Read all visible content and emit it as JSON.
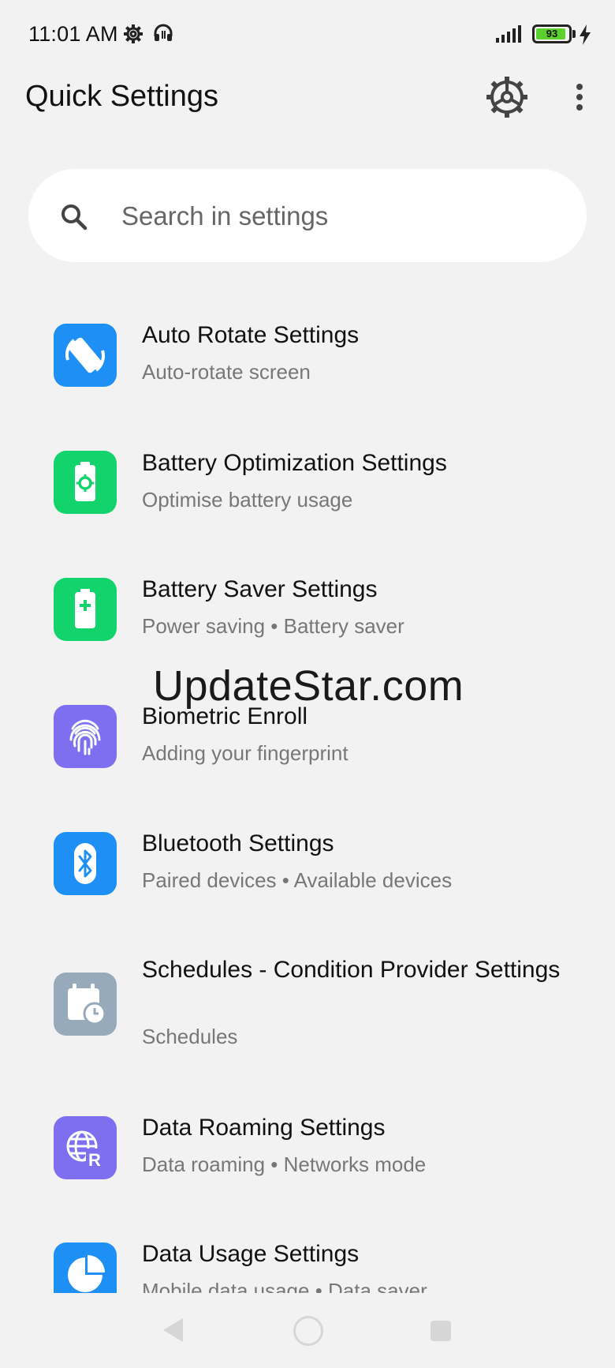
{
  "status_bar": {
    "time": "11:01 AM",
    "battery_level": "93",
    "battery_percent": 93,
    "icons": [
      "settings-gear-icon",
      "headset-icon",
      "signal-icon",
      "battery-icon",
      "charging-icon"
    ]
  },
  "header": {
    "title": "Quick Settings",
    "settings_icon": "gear-icon",
    "more_icon": "more-vert-icon"
  },
  "search": {
    "placeholder": "Search in settings",
    "icon": "search-icon"
  },
  "items": [
    {
      "title": "Auto Rotate Settings",
      "subtitle": "Auto-rotate screen",
      "icon": "rotate-icon",
      "color": "#1e8ff5"
    },
    {
      "title": "Battery Optimization Settings",
      "subtitle": "Optimise battery usage",
      "icon": "battery-gear-icon",
      "color": "#13d46c"
    },
    {
      "title": "Battery Saver Settings",
      "subtitle": "Power saving • Battery saver",
      "icon": "battery-plus-icon",
      "color": "#13d46c"
    },
    {
      "title": "Biometric Enroll",
      "subtitle": "Adding your fingerprint",
      "icon": "fingerprint-icon",
      "color": "#7d6ff0"
    },
    {
      "title": "Bluetooth Settings",
      "subtitle": "Paired devices • Available devices",
      "icon": "bluetooth-icon",
      "color": "#1e8ff5"
    },
    {
      "title": "Schedules - Condition Provider Settings",
      "subtitle": "Schedules",
      "icon": "calendar-clock-icon",
      "color": "#97aabb"
    },
    {
      "title": "Data Roaming Settings",
      "subtitle": "Data roaming • Networks mode",
      "icon": "globe-roaming-icon",
      "color": "#7d6ff0"
    },
    {
      "title": "Data Usage Settings",
      "subtitle": "Mobile data usage • Data saver",
      "icon": "pie-chart-icon",
      "color": "#1e8ff5"
    }
  ],
  "watermark": "UpdateStar.com",
  "nav_bar": {
    "back_icon": "back-triangle-icon",
    "home_icon": "home-circle-icon",
    "recents_icon": "recents-square-icon"
  }
}
